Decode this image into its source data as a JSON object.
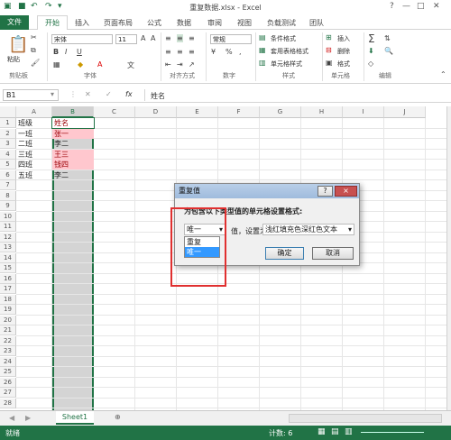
{
  "window": {
    "title": "重复数据.xlsx - Excel"
  },
  "tabs": {
    "file": "文件",
    "home": "开始",
    "insert": "插入",
    "layout": "页面布局",
    "formulas": "公式",
    "data": "数据",
    "review": "审阅",
    "view": "视图",
    "load_test": "负载测试",
    "team": "团队"
  },
  "ribbon": {
    "paste": "粘贴",
    "font_name": "宋体",
    "font_size": "11",
    "number_format": "常规",
    "conditional_format": "条件格式",
    "table_format": "套用表格格式",
    "cell_styles": "单元格样式",
    "insert": "插入",
    "delete": "删除",
    "format": "格式",
    "groups": {
      "clipboard": "剪贴板",
      "font": "字体",
      "alignment": "对齐方式",
      "number": "数字",
      "styles": "样式",
      "cells": "单元格",
      "editing": "编辑"
    }
  },
  "formula_bar": {
    "name_box": "B1",
    "content": "姓名",
    "fx": "fx"
  },
  "columns": [
    "A",
    "B",
    "C",
    "D",
    "E",
    "F",
    "G",
    "H",
    "I",
    "J"
  ],
  "rows": [
    "1",
    "2",
    "3",
    "4",
    "5",
    "6",
    "7",
    "8",
    "9",
    "10",
    "11",
    "12",
    "13",
    "14",
    "15",
    "16",
    "17",
    "18",
    "19",
    "20",
    "21",
    "22",
    "23",
    "24",
    "25",
    "26",
    "27",
    "28"
  ],
  "cells": {
    "A": [
      "班级",
      "一班",
      "二班",
      "三班",
      "四班",
      "五班"
    ],
    "B": [
      "姓名",
      "张一",
      "李二",
      "王三",
      "钱四",
      "李二"
    ]
  },
  "dialog": {
    "title": "重复值",
    "help": "?",
    "close": "×",
    "instruction": "为包含以下类型值的单元格设置格式:",
    "value_select": "唯一",
    "set_as_label": "值，设置为",
    "format_select": "浅红填充色深红色文本",
    "options": [
      "重复",
      "唯一"
    ],
    "ok": "确定",
    "cancel": "取消"
  },
  "sheet_tab": "Sheet1",
  "status": {
    "ready": "就绪",
    "count": "计数: 6"
  },
  "colors": {
    "excel_green": "#217346",
    "highlight_fill": "#ffc7ce",
    "highlight_text": "#9c0006",
    "red_box": "#e03030"
  }
}
